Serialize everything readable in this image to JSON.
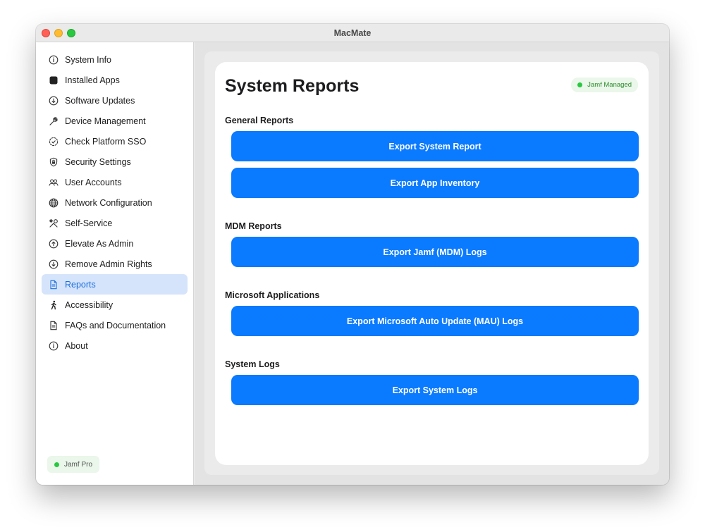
{
  "window": {
    "title": "MacMate"
  },
  "sidebar": {
    "items": [
      {
        "label": "System Info",
        "icon": "info-circle-icon"
      },
      {
        "label": "Installed Apps",
        "icon": "app-square-icon"
      },
      {
        "label": "Software Updates",
        "icon": "arrow-down-circle-icon"
      },
      {
        "label": "Device Management",
        "icon": "wrench-icon"
      },
      {
        "label": "Check Platform SSO",
        "icon": "checkmark-seal-icon"
      },
      {
        "label": "Security Settings",
        "icon": "lock-shield-icon"
      },
      {
        "label": "User Accounts",
        "icon": "two-people-icon"
      },
      {
        "label": "Network Configuration",
        "icon": "globe-icon"
      },
      {
        "label": "Self-Service",
        "icon": "tools-icon"
      },
      {
        "label": "Elevate As Admin",
        "icon": "arrow-up-circle-icon"
      },
      {
        "label": "Remove Admin Rights",
        "icon": "arrow-down-circle-icon"
      },
      {
        "label": "Reports",
        "icon": "document-icon",
        "active": true
      },
      {
        "label": "Accessibility",
        "icon": "walking-figure-icon"
      },
      {
        "label": "FAQs and Documentation",
        "icon": "document-icon"
      },
      {
        "label": "About",
        "icon": "info-circle-icon"
      }
    ],
    "footer_badge": "Jamf Pro"
  },
  "main": {
    "title": "System Reports",
    "status_badge": "Jamf Managed",
    "sections": [
      {
        "title": "General Reports",
        "buttons": [
          "Export System Report",
          "Export App Inventory"
        ]
      },
      {
        "title": "MDM Reports",
        "buttons": [
          "Export Jamf (MDM) Logs"
        ]
      },
      {
        "title": "Microsoft Applications",
        "buttons": [
          "Export Microsoft Auto Update (MAU) Logs"
        ]
      },
      {
        "title": "System Logs",
        "buttons": [
          "Export System Logs"
        ]
      }
    ]
  },
  "colors": {
    "accent": "#0a7aff",
    "active_item_bg": "#d6e4fb",
    "active_item_text": "#1a6fe0",
    "status_green": "#28c840"
  }
}
